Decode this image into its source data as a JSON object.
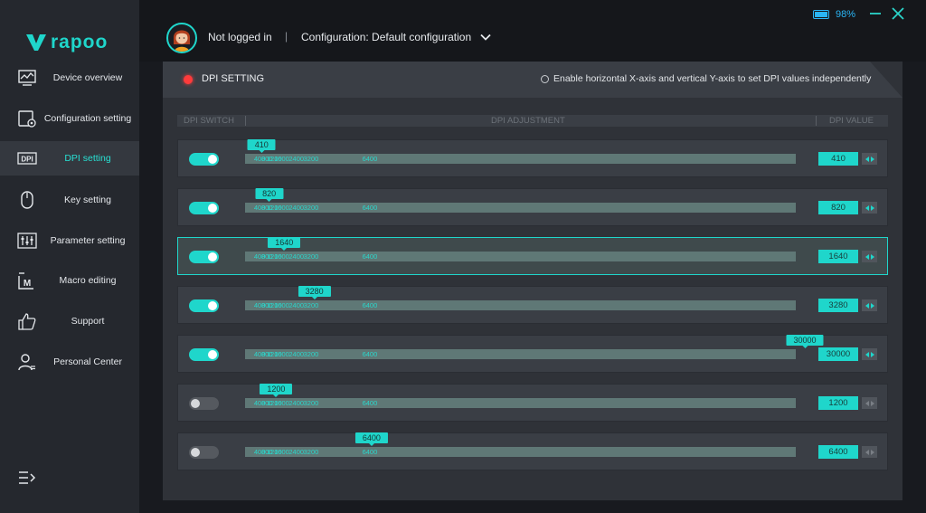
{
  "brand": {
    "logo_text": "rapoo",
    "accent": "#1fd6cb"
  },
  "sidebar": {
    "items": [
      {
        "label": "Device overview",
        "icon": "monitor-chart-icon",
        "active": false
      },
      {
        "label": "Configuration setting",
        "icon": "config-gear-icon",
        "active": false
      },
      {
        "label": "DPI setting",
        "icon": "dpi-icon",
        "active": true
      },
      {
        "label": "Key setting",
        "icon": "mouse-icon",
        "active": false
      },
      {
        "label": "Parameter setting",
        "icon": "sliders-icon",
        "active": false
      },
      {
        "label": "Macro editing",
        "icon": "macro-m-icon",
        "active": false
      },
      {
        "label": "Support",
        "icon": "thumbs-up-icon",
        "active": false
      },
      {
        "label": "Personal Center",
        "icon": "user-icon",
        "active": false
      }
    ]
  },
  "topbar": {
    "battery": "98%",
    "battery_level": 0.98,
    "user_status": "Not logged in",
    "separator": "|",
    "configuration": "Configuration: Default configuration"
  },
  "panel": {
    "title": "DPI SETTING",
    "xy_option": "Enable horizontal X-axis and vertical Y-axis to set DPI values independently",
    "col_switch": "DPI SWITCH",
    "col_adjust": "DPI ADJUSTMENT",
    "col_value": "DPI VALUE"
  },
  "dpi": {
    "max": 30000,
    "ticks": [
      "400",
      "800",
      "1200",
      "1600",
      "2400",
      "3200",
      "6400"
    ],
    "rows": [
      {
        "enabled": true,
        "value": "410",
        "selected": false
      },
      {
        "enabled": true,
        "value": "820",
        "selected": false
      },
      {
        "enabled": true,
        "value": "1640",
        "selected": true
      },
      {
        "enabled": true,
        "value": "3280",
        "selected": false
      },
      {
        "enabled": true,
        "value": "30000",
        "selected": false
      },
      {
        "enabled": false,
        "value": "1200",
        "selected": false
      },
      {
        "enabled": false,
        "value": "6400",
        "selected": false
      }
    ]
  }
}
